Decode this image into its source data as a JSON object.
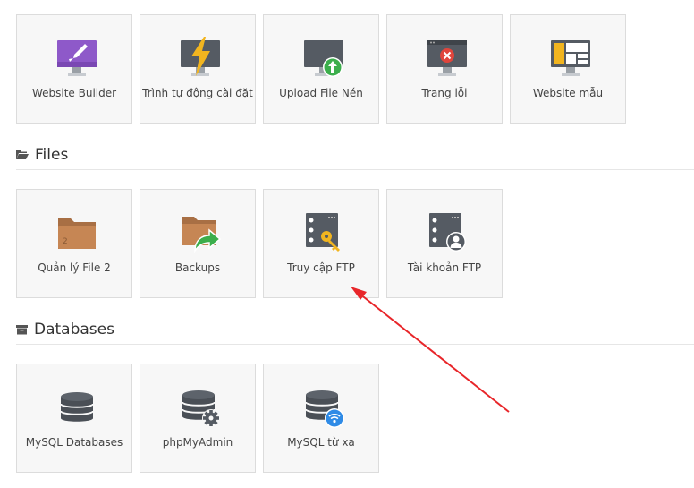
{
  "top_row": [
    {
      "label": "Website Builder",
      "icon": "website-builder-icon"
    },
    {
      "label": "Trình tự động cài đặt",
      "icon": "auto-installer-icon"
    },
    {
      "label": "Upload File Nén",
      "icon": "upload-archive-icon"
    },
    {
      "label": "Trang lỗi",
      "icon": "error-page-icon"
    },
    {
      "label": "Website mẫu",
      "icon": "website-template-icon"
    }
  ],
  "files": {
    "title": "Files",
    "items": [
      {
        "label": "Quản lý File 2",
        "icon": "file-manager-icon"
      },
      {
        "label": "Backups",
        "icon": "backups-icon"
      },
      {
        "label": "Truy cập FTP",
        "icon": "ftp-access-icon"
      },
      {
        "label": "Tài khoản FTP",
        "icon": "ftp-accounts-icon"
      }
    ]
  },
  "databases": {
    "title": "Databases",
    "items": [
      {
        "label": "MySQL Databases",
        "icon": "mysql-databases-icon"
      },
      {
        "label": "phpMyAdmin",
        "icon": "phpmyadmin-icon"
      },
      {
        "label": "MySQL từ xa",
        "icon": "remote-mysql-icon"
      }
    ]
  },
  "annotation": {
    "color": "#e8262a",
    "target": "Truy cập FTP"
  },
  "colors": {
    "tile_bg": "#f7f7f7",
    "tile_border": "#dcdcdc",
    "purple": "#8e59c9",
    "yellow": "#f2b51f",
    "green": "#3cae4c",
    "red": "#e0453c",
    "folder": "#c68654",
    "dark_gray": "#555b63",
    "blue": "#2f8be6"
  }
}
